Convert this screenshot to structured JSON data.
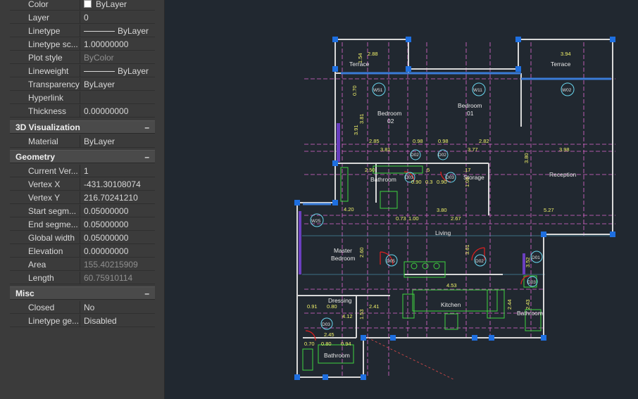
{
  "properties": {
    "general": [
      {
        "key": "Color",
        "value": "ByLayer",
        "kind": "color"
      },
      {
        "key": "Layer",
        "value": "0"
      },
      {
        "key": "Linetype",
        "value": "ByLayer",
        "kind": "linetype"
      },
      {
        "key": "Linetype sc...",
        "value": "1.00000000"
      },
      {
        "key": "Plot style",
        "value": "ByColor",
        "dim": true
      },
      {
        "key": "Lineweight",
        "value": "ByLayer",
        "kind": "linetype"
      },
      {
        "key": "Transparency",
        "value": "ByLayer"
      },
      {
        "key": "Hyperlink",
        "value": ""
      },
      {
        "key": "Thickness",
        "value": "0.00000000"
      }
    ],
    "viz_title": "3D Visualization",
    "viz": [
      {
        "key": "Material",
        "value": "ByLayer"
      }
    ],
    "geometry_title": "Geometry",
    "geometry": [
      {
        "key": "Current Ver...",
        "value": "1"
      },
      {
        "key": "Vertex X",
        "value": "-431.30108074"
      },
      {
        "key": "Vertex Y",
        "value": "216.70241210"
      },
      {
        "key": "Start segm...",
        "value": "0.05000000"
      },
      {
        "key": "End segme...",
        "value": "0.05000000"
      },
      {
        "key": "Global width",
        "value": "0.05000000"
      },
      {
        "key": "Elevation",
        "value": "0.00000000"
      },
      {
        "key": "Area",
        "value": "155.40215909",
        "dim": true
      },
      {
        "key": "Length",
        "value": "60.75910114",
        "dim": true
      }
    ],
    "misc_title": "Misc",
    "misc": [
      {
        "key": "Closed",
        "value": "No"
      },
      {
        "key": "Linetype ge...",
        "value": "Disabled"
      }
    ],
    "collapse_glyph": "–"
  },
  "drawing": {
    "rooms": {
      "terrace_left": "Terrace",
      "terrace_right": "Terrace",
      "bedroom_02_a": "Bedroom",
      "bedroom_02_b": "02",
      "bedroom_01_a": "Bedroom",
      "bedroom_01_b": "01",
      "bathroom_top": "Bathroom",
      "storage": "Storage",
      "reception": "Reception",
      "living": "Living",
      "master_a": "Master",
      "master_b": "Bedroom",
      "dressing": "Dressing",
      "kitchen": "Kitchen",
      "bathroom_right": "Bathroom",
      "bathroom_bottom": "Bathroom"
    },
    "tags": {
      "w51": "W51",
      "w11": "W11",
      "w02": "W02",
      "w25": "W25",
      "d02a": "D02",
      "d02b": "D02",
      "d03a": "D03",
      "d03b": "D03",
      "d05": "D05",
      "d02c": "D02",
      "d01": "D01",
      "d03c": "D03",
      "d03d": "D03"
    },
    "dims": {
      "d288": "2.88",
      "d394": "3.94",
      "d154": "1.54",
      "d070": "0.70",
      "d391": "3.91",
      "d381": "3.81",
      "d285": "2.85",
      "d098a": "0.98",
      "d098b": "0.98",
      "d282": "2.82",
      "d381b": "3.81",
      "d377": "3.77",
      "d398": "3.98",
      "d380v": "3.80",
      "d250": "2.50",
      "d250b": ".5",
      "d117": ".17",
      "d090a": "0.90",
      "d030": "0.3",
      "d090b": "0.90",
      "d106": "1.06",
      "d420": "4.20",
      "d380": "3.80",
      "d527": "5.27",
      "d073": "0.73",
      "d100": "1.00",
      "d267": "2.67",
      "d361": "3.61",
      "d352": "3.52",
      "d260": "2.60",
      "d453": "4.53",
      "d091": "0.91",
      "d080": "0.80",
      "d241": "2.41",
      "d412": "4.12",
      "d153": "1.53",
      "d244": "2.44",
      "d245": "2.45",
      "d070b": "0.70",
      "d080b": "0.80",
      "d094": "0.94",
      "d243": "2.43"
    }
  },
  "colors": {
    "panel_bg": "#3b3b3b",
    "header_bg": "#4a4a4a",
    "viewport_bg": "#212830",
    "wall": "#d8d8d8",
    "grip": "#1e6fe0",
    "dim": "#f2f26a",
    "axis": "#e06ad0",
    "furniture": "#3fd33f",
    "door": "#e02020",
    "tag": "#6ad8f0"
  }
}
